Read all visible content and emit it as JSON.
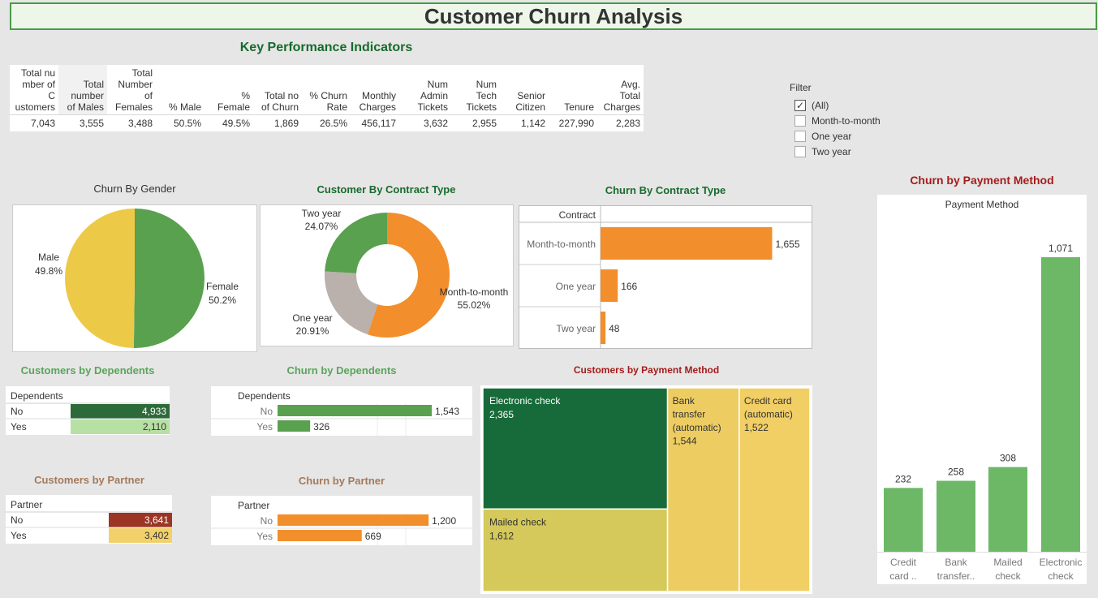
{
  "title": "Customer Churn Analysis",
  "kpi": {
    "title": "Key Performance Indicators",
    "headers": [
      "Total nu mber of C ustomers",
      "Total number of Males",
      "Total Number of Females",
      "% Male",
      "% Female",
      "Total no of Churn",
      "% Churn Rate",
      "Monthly Charges",
      "Num Admin Tickets",
      "Num Tech Tickets",
      "Senior Citizen",
      "Tenure",
      "Avg. Total Charges"
    ],
    "values": [
      "7,043",
      "3,555",
      "3,488",
      "50.5%",
      "49.5%",
      "1,869",
      "26.5%",
      "456,117",
      "3,632",
      "2,955",
      "1,142",
      "227,990",
      "2,283"
    ]
  },
  "filter": {
    "title": "Filter",
    "options": [
      {
        "label": "(All)",
        "checked": true
      },
      {
        "label": "Month-to-month",
        "checked": false
      },
      {
        "label": "One year",
        "checked": false
      },
      {
        "label": "Two year",
        "checked": false
      }
    ]
  },
  "chart_data": [
    {
      "type": "pie",
      "title": "Churn By Gender",
      "slices": [
        {
          "name": "Female",
          "value": 50.2,
          "label": "50.2%",
          "color": "#59a14f"
        },
        {
          "name": "Male",
          "value": 49.8,
          "label": "49.8%",
          "color": "#edc948"
        }
      ]
    },
    {
      "type": "pie",
      "variant": "donut",
      "title": "Customer By Contract Type",
      "slices": [
        {
          "name": "Month-to-month",
          "value": 55.02,
          "label": "55.02%",
          "color": "#f28e2b"
        },
        {
          "name": "One year",
          "value": 20.91,
          "label": "20.91%",
          "color": "#bab0ac"
        },
        {
          "name": "Two year",
          "value": 24.07,
          "label": "24.07%",
          "color": "#59a14f"
        }
      ]
    },
    {
      "type": "bar",
      "orientation": "horizontal",
      "title": "Churn By Contract Type",
      "dimension": "Contract",
      "categories": [
        "Month-to-month",
        "One year",
        "Two year"
      ],
      "values": [
        1655,
        166,
        48
      ],
      "labels": [
        "1,655",
        "166",
        "48"
      ],
      "color": "#f28e2b"
    },
    {
      "type": "bar",
      "title": "Churn by Payment Method",
      "subtitle": "Payment Method",
      "categories": [
        [
          "Credit",
          "card .."
        ],
        [
          "Bank",
          "transfer.."
        ],
        [
          "Mailed",
          "check"
        ],
        [
          "Electronic",
          "check"
        ]
      ],
      "values": [
        232,
        258,
        308,
        1071
      ],
      "labels": [
        "232",
        "258",
        "308",
        "1,071"
      ],
      "color": "#6db866"
    },
    {
      "type": "table",
      "title": "Customers by Dependents",
      "dimension": "Dependents",
      "rows": [
        {
          "name": "No",
          "value": 4933,
          "label": "4,933",
          "color": "#2d6a3a"
        },
        {
          "name": "Yes",
          "value": 2110,
          "label": "2,110",
          "color": "#b7e0a4"
        }
      ]
    },
    {
      "type": "bar",
      "orientation": "horizontal",
      "title": "Churn by Dependents",
      "dimension": "Dependents",
      "categories": [
        "No",
        "Yes"
      ],
      "values": [
        1543,
        326
      ],
      "labels": [
        "1,543",
        "326"
      ],
      "color": "#59a14f"
    },
    {
      "type": "table",
      "title": "Customers by Partner",
      "dimension": "Partner",
      "rows": [
        {
          "name": "No",
          "value": 3641,
          "label": "3,641",
          "color": "#9c3524"
        },
        {
          "name": "Yes",
          "value": 3402,
          "label": "3,402",
          "color": "#f2d16b"
        }
      ]
    },
    {
      "type": "bar",
      "orientation": "horizontal",
      "title": "Churn by Partner",
      "dimension": "Partner",
      "categories": [
        "No",
        "Yes"
      ],
      "values": [
        1200,
        669
      ],
      "labels": [
        "1,200",
        "669"
      ],
      "color": "#f28e2b"
    },
    {
      "type": "treemap",
      "title": "Customers by Payment Method",
      "items": [
        {
          "name": "Electronic check",
          "value": 2365,
          "label": "2,365",
          "color": "#176b3a",
          "text_color": "#ffffff"
        },
        {
          "name": "Mailed check",
          "value": 1612,
          "label": "1,612",
          "color": "#d4c95a",
          "text_color": "#333333"
        },
        {
          "name": "Bank transfer (automatic)",
          "value": 1544,
          "label": "1,544",
          "color": "#edcd62",
          "text_color": "#333333"
        },
        {
          "name": "Credit card (automatic)",
          "value": 1522,
          "label": "1,522",
          "color": "#f1cf65",
          "text_color": "#333333"
        }
      ]
    }
  ],
  "colors": {
    "title_border": "#4a9b4a",
    "green_title": "#176b2c",
    "light_green_title": "#5aa55a",
    "red_title": "#a41d1d",
    "brown_title": "#a47a5a"
  }
}
